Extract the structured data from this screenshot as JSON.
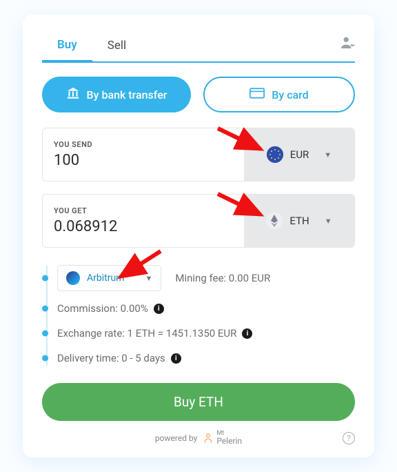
{
  "tabs": {
    "buy": "Buy",
    "sell": "Sell"
  },
  "payment": {
    "bank": "By bank transfer",
    "card": "By card"
  },
  "send": {
    "label": "YOU SEND",
    "value": "100",
    "currency": "EUR"
  },
  "get": {
    "label": "YOU GET",
    "value": "0.068912",
    "currency": "ETH"
  },
  "network": {
    "name": "Arbitrum",
    "mining_fee": "Mining fee: 0.00 EUR"
  },
  "details": {
    "commission": "Commission: 0.00%",
    "rate": "Exchange rate: 1 ETH = 1451.1350 EUR",
    "delivery": "Delivery time: 0 - 5 days"
  },
  "cta": "Buy ETH",
  "footer": {
    "powered": "powered by",
    "brand_top": "Mt",
    "brand_bottom": "Pelerin"
  }
}
